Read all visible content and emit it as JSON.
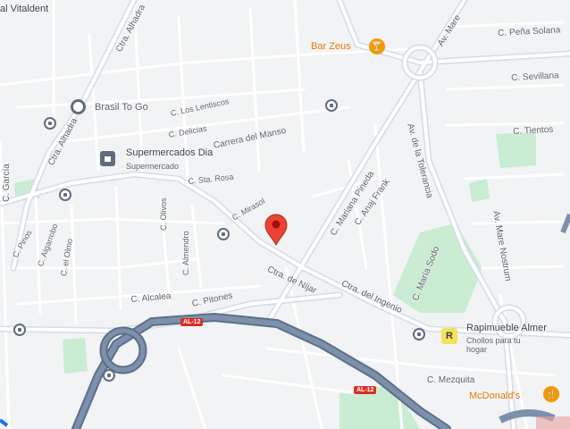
{
  "labels": {
    "vitaldent": "al Vitaldent",
    "c_garcia": "C. García",
    "ctra_alhadra": "Ctra. Alhadra",
    "c_lentiscos": "C. Los Lentiscos",
    "c_delicias": "C. Delicias",
    "carrera_manso": "Carrera del Manso",
    "c_sta_rosa": "C. Sta. Rosa",
    "c_mirasol": "C. Mirasol",
    "c_marina_pineda": "C. Mariana Pineda",
    "c_abaj_frank": "C. Anaj Frank",
    "av_tolerancia": "Av. de la Tolerancia",
    "c_pena_solana": "C. Peña Solana",
    "c_sevillana": "C. Sevillana",
    "c_tientos": "C. Tientos",
    "av_mare_nostrum": "Av. Mare Nostrum",
    "c_maria_sodo": "C. María Sodo",
    "cira_de_nijar": "Ctra. de Níjar",
    "cira_del_ingenio": "Ctra. del Ingenio",
    "c_olivos": "C. Olivos",
    "c_pinos": "C. Pinos",
    "c_alcalea": "C. Alcalea",
    "c_pitones": "C. Pitones",
    "c_el_olmo": "C. el Olmo",
    "c_almendro": "C. Almendro",
    "c_mezquita": "C. Mezquita",
    "c_algarrobo": "C. Algarrobo",
    "av_mare_top": "Av. Mare"
  },
  "pois": {
    "bar_zeus": "Bar Zeus",
    "brasil_to_go": "Brasil To Go",
    "supermercados_dia": "Supermercados Dia",
    "supermercados_dia_sub": "Supermercado",
    "rapimueble": "Rapimueble Almer",
    "rapimueble_sub": "Chollos para tu hogar",
    "mcdonalds": "McDonald's"
  },
  "road_shields": {
    "al12_a": "AL-12",
    "al12_b": "AL-12"
  },
  "colors": {
    "background": "#f1f3f4",
    "road": "#ffffff",
    "major_road": "#c5cdd8",
    "highway": "#6e7f99",
    "park": "#c9ecd3",
    "pin": "#ea4335",
    "food": "#f29900",
    "shopping": "#1a73e8"
  }
}
